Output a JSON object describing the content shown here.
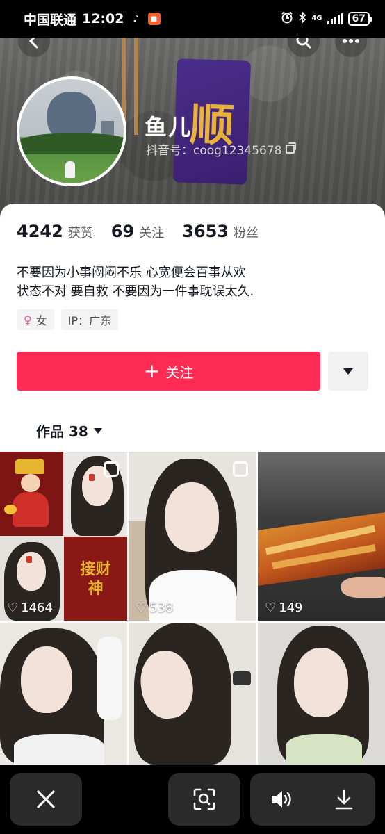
{
  "status_bar": {
    "carrier": "中国联通",
    "time": "12:02",
    "network": "4G",
    "battery": "67"
  },
  "profile": {
    "nickname": "鱼儿",
    "douyin_id": "抖音号：coog12345678",
    "cover_card_text": "顺"
  },
  "stats": [
    {
      "value": "4242",
      "label": "获赞"
    },
    {
      "value": "69",
      "label": "关注"
    },
    {
      "value": "3653",
      "label": "粉丝"
    }
  ],
  "bio": [
    "不要因为小事闷闷不乐 心宽便会百事从欢",
    "状态不对 要自救 不要因为一件事耽误太久."
  ],
  "tags": {
    "gender": "女",
    "ip": "IP：广东"
  },
  "actions": {
    "follow_label": "关注"
  },
  "works_tab": {
    "label": "作品 38"
  },
  "videos": [
    {
      "likes": "1464",
      "sticker_text": "接财神"
    },
    {
      "likes": "538"
    },
    {
      "likes": "149"
    },
    {
      "likes": ""
    },
    {
      "likes": ""
    },
    {
      "likes": ""
    }
  ],
  "colors": {
    "follow_button": "#fe2c55",
    "status_bar": "#000000",
    "bottom_bar": "#000000"
  },
  "icons": {
    "back": "chevron-left-icon",
    "search": "search-icon",
    "more": "more-dots-icon",
    "close": "close-icon",
    "scan": "scan-icon",
    "volume": "volume-icon",
    "download": "download-icon"
  }
}
